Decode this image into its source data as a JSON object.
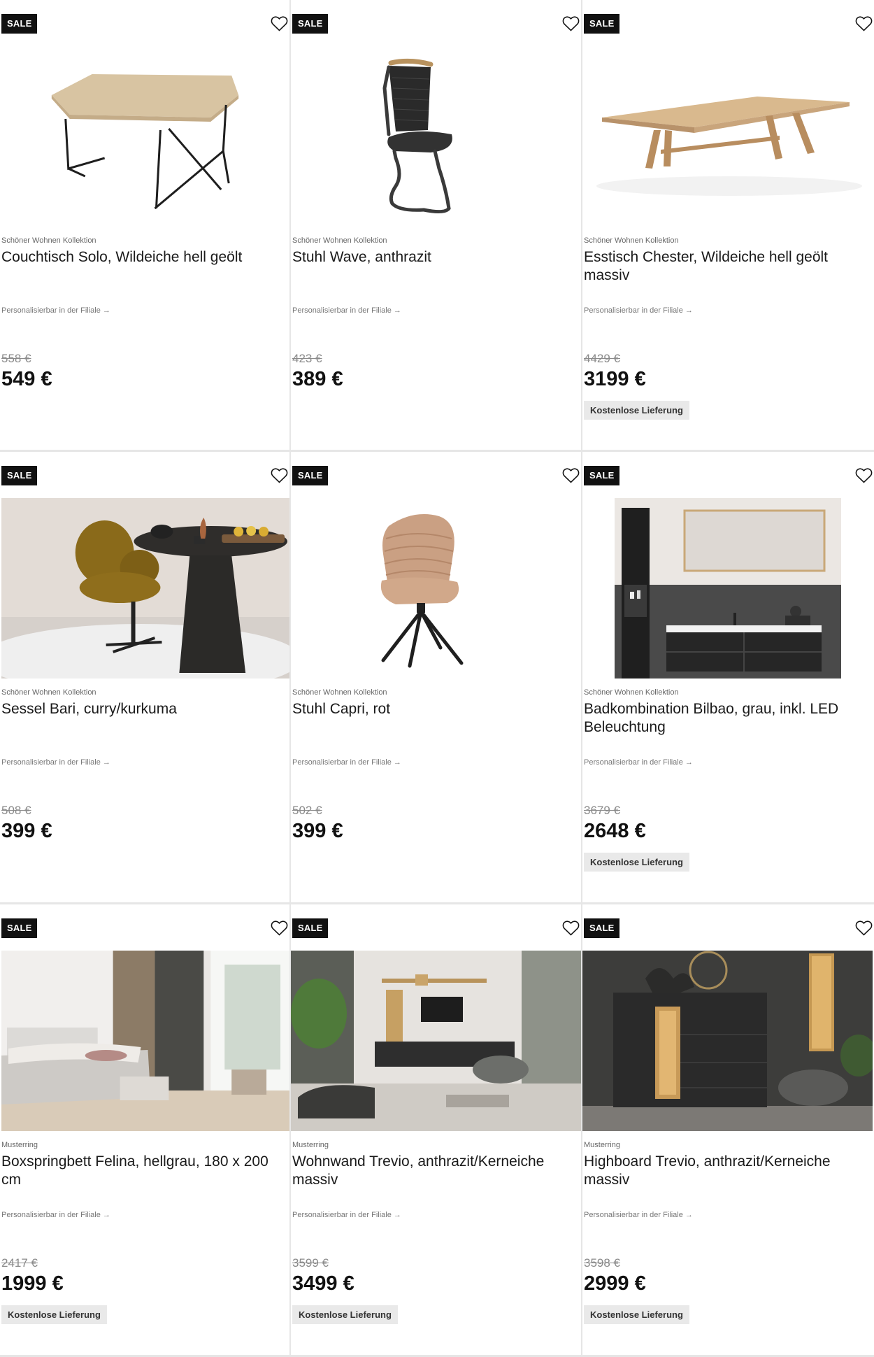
{
  "icons": {
    "wishlist": "heart-outline-icon",
    "arrow": "arrow-right-icon"
  },
  "products": [
    {
      "badge": "SALE",
      "brand": "Schöner Wohnen Kollektion",
      "title": "Couchtisch Solo, Wildeiche hell geölt",
      "personalize": "Personalisierbar in der Filiale →",
      "old_price": "558 €",
      "price": "549 €",
      "delivery": "",
      "image": "coffee-table"
    },
    {
      "badge": "SALE",
      "brand": "Schöner Wohnen Kollektion",
      "title": "Stuhl Wave, anthrazit",
      "personalize": "Personalisierbar in der Filiale →",
      "old_price": "423 €",
      "price": "389 €",
      "delivery": "",
      "image": "cantilever-chair"
    },
    {
      "badge": "SALE",
      "brand": "Schöner Wohnen Kollektion",
      "title": "Esstisch Chester, Wildeiche hell geölt massiv",
      "personalize": "Personalisierbar in der Filiale →",
      "old_price": "4429 €",
      "price": "3199 €",
      "delivery": "Kostenlose Lieferung",
      "image": "dining-table"
    },
    {
      "badge": "SALE",
      "brand": "Schöner Wohnen Kollektion",
      "title": "Sessel Bari, curry/kurkuma",
      "personalize": "Personalisierbar in der Filiale →",
      "old_price": "508 €",
      "price": "399 €",
      "delivery": "",
      "image": "armchair-scene"
    },
    {
      "badge": "SALE",
      "brand": "Schöner Wohnen Kollektion",
      "title": "Stuhl Capri, rot",
      "personalize": "Personalisierbar in der Filiale →",
      "old_price": "502 €",
      "price": "399 €",
      "delivery": "",
      "image": "swivel-chair"
    },
    {
      "badge": "SALE",
      "brand": "Schöner Wohnen Kollektion",
      "title": "Badkombination Bilbao, grau, inkl. LED Beleuchtung",
      "personalize": "Personalisierbar in der Filiale →",
      "old_price": "3679 €",
      "price": "2648 €",
      "delivery": "Kostenlose Lieferung",
      "image": "bathroom"
    },
    {
      "badge": "SALE",
      "brand": "Musterring",
      "title": "Boxspringbett Felina, hellgrau, 180 x 200 cm",
      "personalize": "Personalisierbar in der Filiale →",
      "old_price": "2417 €",
      "price": "1999 €",
      "delivery": "Kostenlose Lieferung",
      "image": "bedroom"
    },
    {
      "badge": "SALE",
      "brand": "Musterring",
      "title": "Wohnwand Trevio, anthrazit/Kerneiche massiv",
      "personalize": "Personalisierbar in der Filiale →",
      "old_price": "3599 €",
      "price": "3499 €",
      "delivery": "Kostenlose Lieferung",
      "image": "living-room"
    },
    {
      "badge": "SALE",
      "brand": "Musterring",
      "title": "Highboard Trevio, anthrazit/Kerneiche massiv",
      "personalize": "Personalisierbar in der Filiale →",
      "old_price": "3598 €",
      "price": "2999 €",
      "delivery": "Kostenlose Lieferung",
      "image": "highboard"
    }
  ]
}
